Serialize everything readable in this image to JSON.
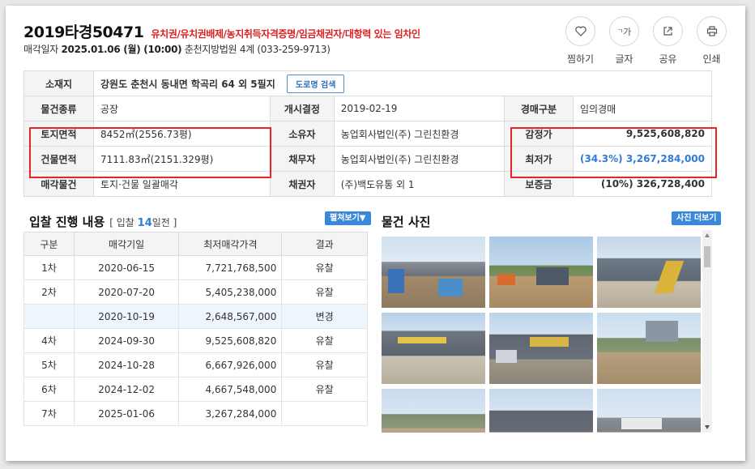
{
  "header": {
    "case_number": "2019타경50471",
    "warning_tags": "유치권/유치권배제/농지취득자격증명/임금채권자/대항력 있는 임차인",
    "sale_label": "매각일자",
    "sale_date": "2025.01.06 (월) (10:00)",
    "court": "춘천지방법원 4계 (033-259-9713)"
  },
  "actions": [
    {
      "label": "찜하기",
      "icon": "heart-icon"
    },
    {
      "label": "글자",
      "icon": "font-size-icon",
      "glyph": "가"
    },
    {
      "label": "공유",
      "icon": "share-icon"
    },
    {
      "label": "인쇄",
      "icon": "print-icon"
    }
  ],
  "info": {
    "location_h": "소재지",
    "location": "강원도 춘천시 동내면 학곡리 64 외 5필지",
    "road_btn": "도로명 검색",
    "type_h": "물건종류",
    "type": "공장",
    "open_h": "개시결정",
    "open": "2019-02-19",
    "auction_h": "경매구분",
    "auction": "임의경매",
    "land_h": "토지면적",
    "land": "8452㎡(2556.73평)",
    "owner_h": "소유자",
    "owner": "농업회사법인(주) 그린친환경",
    "appraisal_h": "감정가",
    "appraisal": "9,525,608,820",
    "bldg_h": "건물면적",
    "bldg": "7111.83㎡(2151.329평)",
    "debtor_h": "채무자",
    "debtor": "농업회사법인(주) 그린친환경",
    "min_h": "최저가",
    "min": "(34.3%) 3,267,284,000",
    "item_h": "매각물건",
    "item": "토지·건물 일괄매각",
    "creditor_h": "채권자",
    "creditor": "(주)백도유통 외 1",
    "deposit_h": "보증금",
    "deposit": "(10%) 326,728,400"
  },
  "bid_section": {
    "title": "입찰 진행 내용",
    "sub_open": "[ 입찰",
    "count": "14",
    "sub_close": "일전 ]",
    "expand_btn": "펼쳐보기▼",
    "columns": [
      "구분",
      "매각기일",
      "최저매각가격",
      "결과"
    ],
    "rows": [
      {
        "round": "1차",
        "date": "2020-06-15",
        "price": "7,721,768,500",
        "result": "유찰"
      },
      {
        "round": "2차",
        "date": "2020-07-20",
        "price": "5,405,238,000",
        "result": "유찰"
      },
      {
        "round": "",
        "date": "2020-10-19",
        "price": "2,648,567,000",
        "result": "변경"
      },
      {
        "round": "4차",
        "date": "2024-09-30",
        "price": "9,525,608,820",
        "result": "유찰"
      },
      {
        "round": "5차",
        "date": "2024-10-28",
        "price": "6,667,926,000",
        "result": "유찰"
      },
      {
        "round": "6차",
        "date": "2024-12-02",
        "price": "4,667,548,000",
        "result": "유찰"
      },
      {
        "round": "7차",
        "date": "2025-01-06",
        "price": "3,267,284,000",
        "result": ""
      }
    ]
  },
  "photo_section": {
    "title": "물건 사진",
    "more_btn": "사진 더보기"
  }
}
